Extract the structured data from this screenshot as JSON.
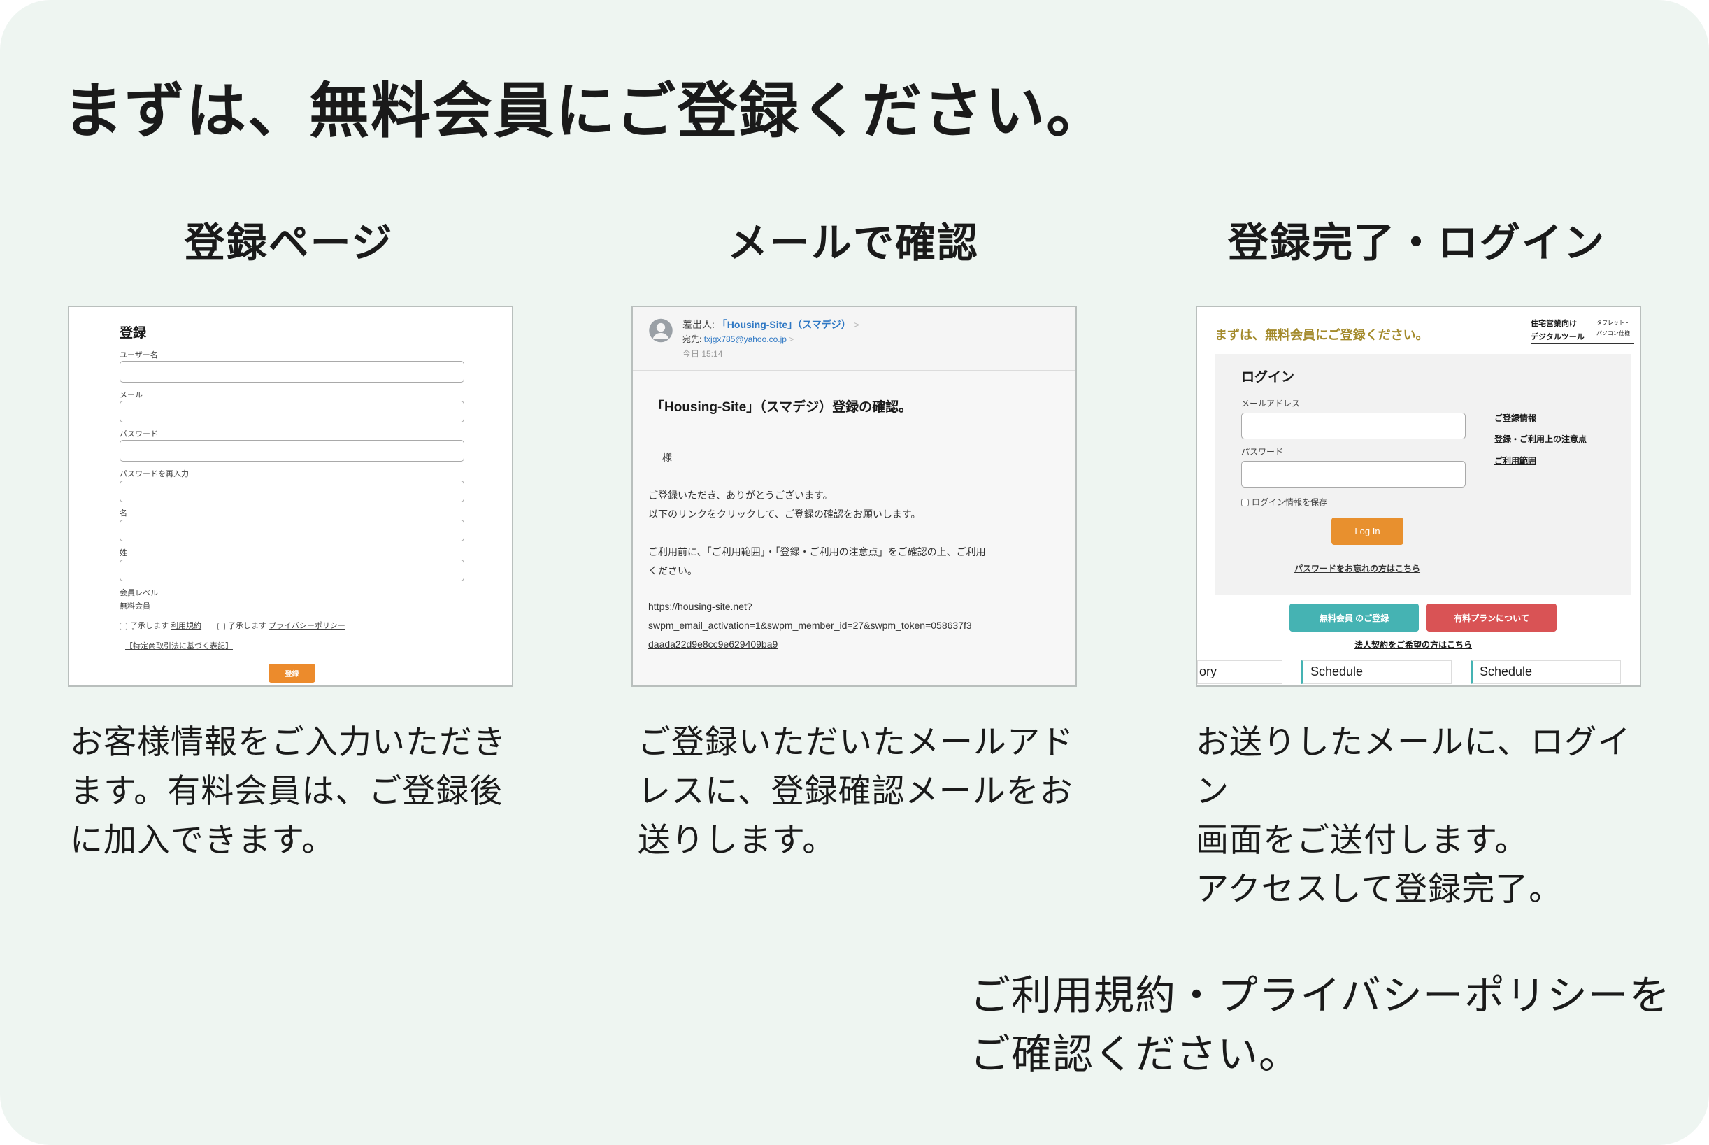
{
  "title": "まずは、無料会員にご登録ください。",
  "steps": [
    {
      "heading": "登録ページ",
      "description": "お客様情報をご入力いただきます。有料会員は、ご登録後に加入できます。"
    },
    {
      "heading": "メールで確認",
      "description": "ご登録いただいたメールアドレスに、登録確認メールをお送りします。"
    },
    {
      "heading": "登録完了・ログイン",
      "description_lines": [
        "お送りしたメールに、ログイン",
        "画面をご送付します。",
        "アクセスして登録完了。"
      ]
    }
  ],
  "register_form": {
    "heading": "登録",
    "fields": [
      "ユーザー名",
      "メール",
      "パスワード",
      "パスワードを再入力",
      "名",
      "姓"
    ],
    "level_label": "会員レベル",
    "level_value": "無料会員",
    "agree1_prefix": "了承します",
    "agree1_link": "利用規約",
    "agree2_prefix": "了承します",
    "agree2_link": "プライバシーポリシー",
    "legal_link": "【特定商取引法に基づく表記】",
    "submit": "登録",
    "button_color": "#ec8b2c"
  },
  "email": {
    "from_label": "差出人:",
    "from": "「Housing-Site」（スマデジ）",
    "to_label": "宛先:",
    "to": "txjgx785@yahoo.co.jp",
    "time": "今日 15:14",
    "subject": "「Housing-Site」（スマデジ）登録の確認。",
    "salutation": "様",
    "body": [
      "ご登録いただき、ありがとうございます。",
      "以下のリンクをクリックして、ご登録の確認をお願いします。",
      "ご利用前に、「ご利用範囲」・「登録・ご利用の注意点」をご確認の上、ご利用",
      "ください。"
    ],
    "link": [
      "https://housing-site.net?",
      "swpm_email_activation=1&swpm_member_id=27&swpm_token=058637f3",
      "daada22d9e8cc9e629409ba9"
    ]
  },
  "login_page": {
    "banner": "まずは、無料会員にご登録ください。",
    "logo_line1": "住宅営業向け",
    "logo_line2": "デジタルツール",
    "logo_sub1": "タブレット・",
    "logo_sub2": "パソコン仕様",
    "heading": "ログイン",
    "email_label": "メールアドレス",
    "password_label": "パスワード",
    "remember": "ログイン情報を保存",
    "login_button": "Log In",
    "forgot": "パスワードをお忘れの方はこちら",
    "side_links": [
      "ご登録情報",
      "登録・ご利用上の注意点",
      "ご利用範囲"
    ],
    "free_button": "無料会員 のご登録",
    "paid_button": "有料プランについて",
    "corporate": "法人契約をご希望の方はこちら",
    "cards": [
      "ory",
      "Schedule",
      "Schedule"
    ],
    "colors": {
      "gold": "#a38a2b",
      "orange": "#e8902e",
      "teal": "#45b3b3",
      "red": "#d95355"
    }
  },
  "note_lines": [
    "ご利用規約・プライバシーポリシーを",
    "ご確認ください。"
  ]
}
